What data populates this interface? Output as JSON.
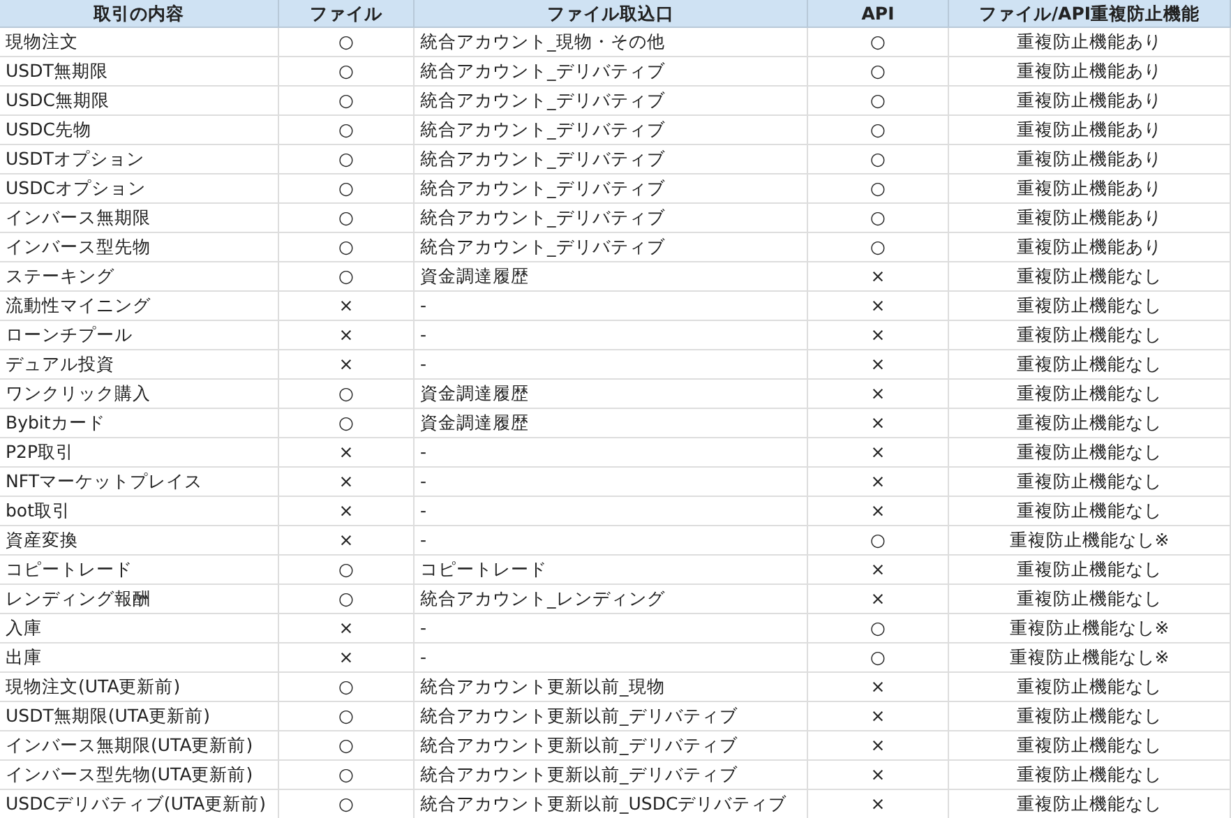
{
  "table": {
    "columns": [
      "取引の内容",
      "ファイル",
      "ファイル取込口",
      "API",
      "ファイル/API重複防止機能"
    ],
    "rows": [
      [
        "現物注文",
        "○",
        "統合アカウント_現物・その他",
        "○",
        "重複防止機能あり"
      ],
      [
        "USDT無期限",
        "○",
        "統合アカウント_デリバティブ",
        "○",
        "重複防止機能あり"
      ],
      [
        "USDC無期限",
        "○",
        "統合アカウント_デリバティブ",
        "○",
        "重複防止機能あり"
      ],
      [
        "USDC先物",
        "○",
        "統合アカウント_デリバティブ",
        "○",
        "重複防止機能あり"
      ],
      [
        "USDTオプション",
        "○",
        "統合アカウント_デリバティブ",
        "○",
        "重複防止機能あり"
      ],
      [
        "USDCオプション",
        "○",
        "統合アカウント_デリバティブ",
        "○",
        "重複防止機能あり"
      ],
      [
        "インバース無期限",
        "○",
        "統合アカウント_デリバティブ",
        "○",
        "重複防止機能あり"
      ],
      [
        "インバース型先物",
        "○",
        "統合アカウント_デリバティブ",
        "○",
        "重複防止機能あり"
      ],
      [
        "ステーキング",
        "○",
        "資金調達履歴",
        "×",
        "重複防止機能なし"
      ],
      [
        "流動性マイニング",
        "×",
        "-",
        "×",
        "重複防止機能なし"
      ],
      [
        "ローンチプール",
        "×",
        "-",
        "×",
        "重複防止機能なし"
      ],
      [
        "デュアル投資",
        "×",
        "-",
        "×",
        "重複防止機能なし"
      ],
      [
        "ワンクリック購入",
        "○",
        "資金調達履歴",
        "×",
        "重複防止機能なし"
      ],
      [
        "Bybitカード",
        "○",
        "資金調達履歴",
        "×",
        "重複防止機能なし"
      ],
      [
        "P2P取引",
        "×",
        "-",
        "×",
        "重複防止機能なし"
      ],
      [
        "NFTマーケットプレイス",
        "×",
        "-",
        "×",
        "重複防止機能なし"
      ],
      [
        "bot取引",
        "×",
        "-",
        "×",
        "重複防止機能なし"
      ],
      [
        "資産変換",
        "×",
        "-",
        "○",
        "重複防止機能なし※"
      ],
      [
        "コピートレード",
        "○",
        "コピートレード",
        "×",
        "重複防止機能なし"
      ],
      [
        "レンディング報酬",
        "○",
        "統合アカウント_レンディング",
        "×",
        "重複防止機能なし"
      ],
      [
        "入庫",
        "×",
        "-",
        "○",
        "重複防止機能なし※"
      ],
      [
        "出庫",
        "×",
        "-",
        "○",
        "重複防止機能なし※"
      ],
      [
        "現物注文(UTA更新前)",
        "○",
        "統合アカウント更新以前_現物",
        "×",
        "重複防止機能なし"
      ],
      [
        "USDT無期限(UTA更新前)",
        "○",
        "統合アカウント更新以前_デリバティブ",
        "×",
        "重複防止機能なし"
      ],
      [
        "インバース無期限(UTA更新前)",
        "○",
        "統合アカウント更新以前_デリバティブ",
        "×",
        "重複防止機能なし"
      ],
      [
        "インバース型先物(UTA更新前)",
        "○",
        "統合アカウント更新以前_デリバティブ",
        "×",
        "重複防止機能なし"
      ],
      [
        "USDCデリバティブ(UTA更新前)",
        "○",
        "統合アカウント更新以前_USDCデリバティブ",
        "×",
        "重複防止機能なし"
      ]
    ]
  }
}
